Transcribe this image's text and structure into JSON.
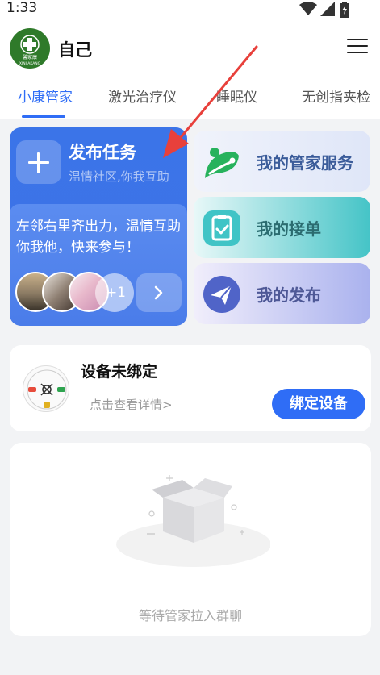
{
  "status_bar": {
    "time": "1:33",
    "icons": [
      "wifi-icon",
      "signal-icon",
      "battery-icon"
    ]
  },
  "header": {
    "title": "自己",
    "logo_text": "馨家康",
    "logo_subtext": "XINJIAKANG"
  },
  "tabs": [
    {
      "label": "小康管家",
      "active": true
    },
    {
      "label": "激光治疗仪",
      "active": false
    },
    {
      "label": "睡眠仪",
      "active": false
    },
    {
      "label": "无创指夹检",
      "active": false
    }
  ],
  "publish": {
    "title": "发布任务",
    "subtitle": "温情社区,你我互助",
    "description": "左邻右里齐出力，温情互助你我他，快来参与！",
    "more_count": "+1"
  },
  "services": [
    {
      "label": "我的管家服务",
      "icon": "leaf-icon"
    },
    {
      "label": "我的接单",
      "icon": "clipboard-check-icon"
    },
    {
      "label": "我的发布",
      "icon": "paper-plane-icon"
    }
  ],
  "device": {
    "title": "设备未绑定",
    "detail_link": "点击查看详情>",
    "bind_button": "绑定设备"
  },
  "empty_state": {
    "message": "等待管家拉入群聊"
  },
  "colors": {
    "accent": "#2f6df6",
    "publish_card": "#3b74e8",
    "annotation_arrow": "#e8403b"
  }
}
